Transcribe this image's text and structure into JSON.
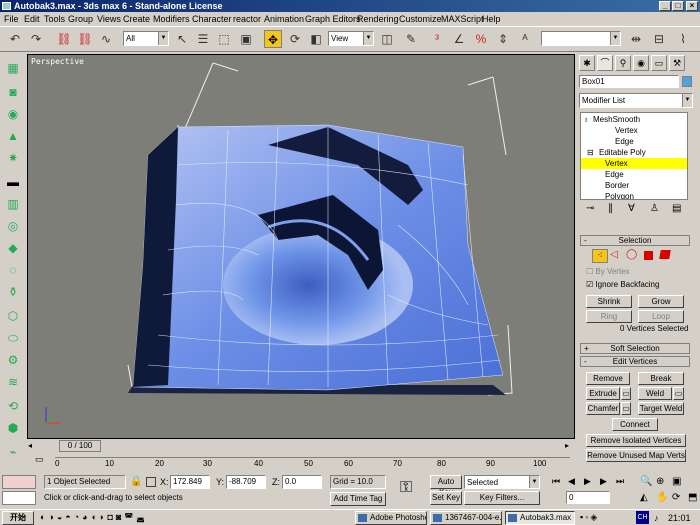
{
  "window": {
    "title": "Autobak3.max - 3ds max 6 - Stand-alone License",
    "min": "_",
    "max": "□",
    "close": "×"
  },
  "menu": [
    "File",
    "Edit",
    "Tools",
    "Group",
    "Views",
    "Create",
    "Modifiers",
    "Character",
    "reactor",
    "Animation",
    "Graph Editors",
    "Rendering",
    "Customize",
    "MAXScript",
    "Help"
  ],
  "toolbar": {
    "selection_filter": "All",
    "ref_coord": "View",
    "named_sel": ""
  },
  "viewport": {
    "label": "Perspective"
  },
  "panel": {
    "object_name": "Box01",
    "modifier_list": "Modifier List",
    "stack": [
      {
        "label": "MeshSmooth",
        "level": 0
      },
      {
        "label": "Vertex",
        "level": 1
      },
      {
        "label": "Edge",
        "level": 1
      },
      {
        "label": "Editable Poly",
        "level": 0
      },
      {
        "label": "Vertex",
        "level": 1,
        "selected": true
      },
      {
        "label": "Edge",
        "level": 1
      },
      {
        "label": "Border",
        "level": 1
      },
      {
        "label": "Polygon",
        "level": 1
      }
    ],
    "selection": {
      "header": "Selection",
      "by_vertex": "By Vertex",
      "ignore_backfacing": "Ignore Backfacing",
      "shrink": "Shrink",
      "grow": "Grow",
      "ring": "Ring",
      "loop": "Loop",
      "status": "0 Vertices Selected"
    },
    "soft_selection": {
      "header": "Soft Selection",
      "toggle": "+"
    },
    "edit_vertices": {
      "header": "Edit Vertices",
      "toggle": "-",
      "remove": "Remove",
      "break": "Break",
      "extrude": "Extrude",
      "weld": "Weld",
      "chamfer": "Chamfer",
      "target_weld": "Target Weld",
      "connect": "Connect",
      "remove_isolated": "Remove Isolated Vertices",
      "remove_unused": "Remove Unused Map Verts"
    },
    "sel_toggle": "-"
  },
  "timeline": {
    "slider": "0 / 100",
    "ticks": [
      "0",
      "10",
      "20",
      "30",
      "40",
      "50",
      "60",
      "70",
      "80",
      "90",
      "100"
    ]
  },
  "status": {
    "objects": "1 Object Selected",
    "prompt": "Click or click-and-drag to select objects",
    "x_label": "X:",
    "x": "172.849",
    "y_label": "Y:",
    "y": "-88.709",
    "z_label": "Z:",
    "z": "0.0",
    "grid": "Grid = 10.0",
    "add_time_tag": "Add Time Tag",
    "auto_key": "Auto Key",
    "auto_key_mode": "Selected",
    "set_key": "Set Key",
    "key_filters": "Key Filters...",
    "frame": "0"
  },
  "taskbar": {
    "start": "开始",
    "items": [
      "Adobe Photoshop",
      "1367467-004-e...",
      "Autobak3.max - ..."
    ],
    "lang": "CH",
    "clock": "21:01"
  }
}
